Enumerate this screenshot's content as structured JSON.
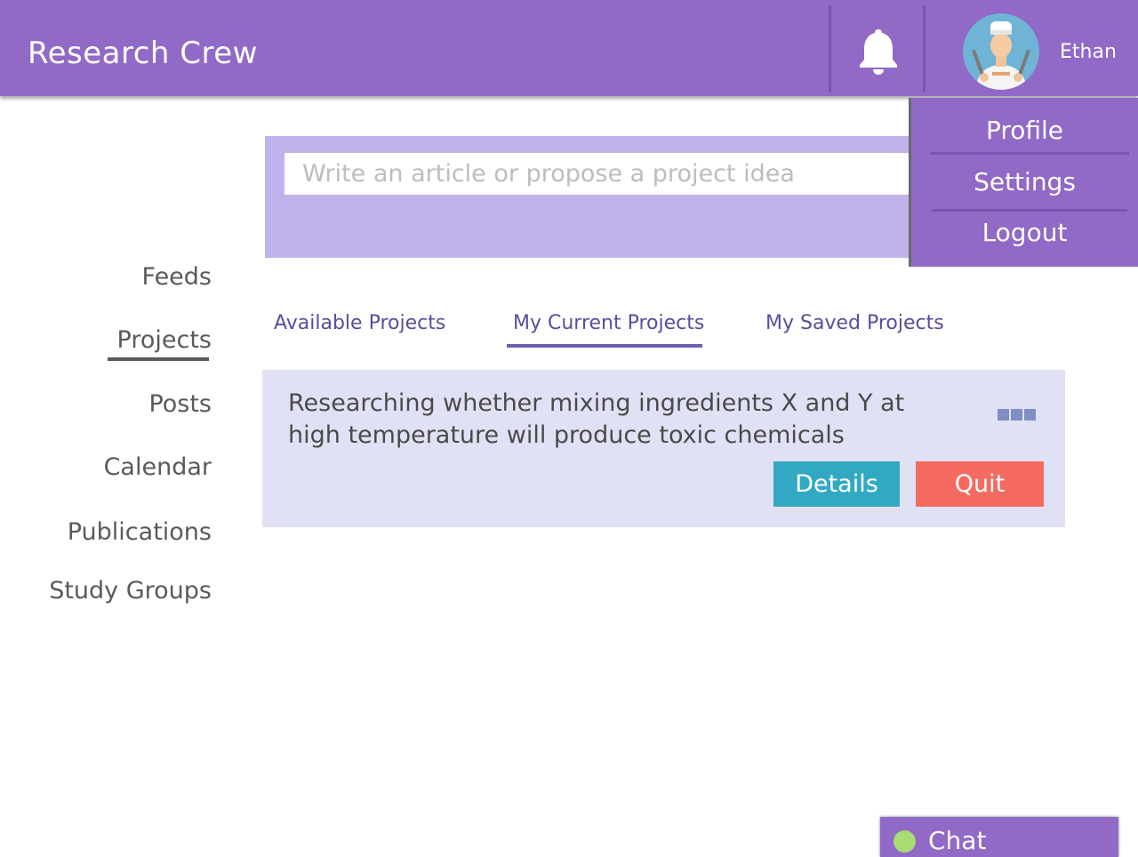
{
  "app": {
    "title": "Research Crew"
  },
  "header": {
    "notifications_icon": "bell-icon",
    "user": {
      "name": "Ethan",
      "avatar_icon": "avatar-chef"
    }
  },
  "user_menu": {
    "items": [
      {
        "label": "Profile"
      },
      {
        "label": "Settings"
      },
      {
        "label": "Logout"
      }
    ]
  },
  "composer": {
    "placeholder": "Write an article or propose a project idea",
    "value": ""
  },
  "nav": {
    "items": [
      {
        "label": "Feeds",
        "active": false
      },
      {
        "label": "Projects",
        "active": true
      },
      {
        "label": "Posts",
        "active": false
      },
      {
        "label": "Calendar",
        "active": false
      },
      {
        "label": "Publications",
        "active": false
      },
      {
        "label": "Study Groups",
        "active": false
      }
    ]
  },
  "project_tabs": {
    "tabs": [
      {
        "label": "Available Projects",
        "active": false
      },
      {
        "label": "My Current Projects",
        "active": true
      },
      {
        "label": "My Saved Projects",
        "active": false
      }
    ]
  },
  "projects": [
    {
      "title": "Researching whether mixing ingredients X and Y at high temperature will produce toxic chemicals",
      "details_label": "Details",
      "quit_label": "Quit"
    }
  ],
  "chat": {
    "label": "Chat",
    "status": "online"
  },
  "colors": {
    "primary": "#9169c6",
    "composer_bg": "#c0b3ec",
    "card_bg": "#e1e1f5",
    "tab_text": "#5a4d9c",
    "details_button": "#32a9c2",
    "quit_button": "#f56b61",
    "online": "#a9dc73"
  }
}
